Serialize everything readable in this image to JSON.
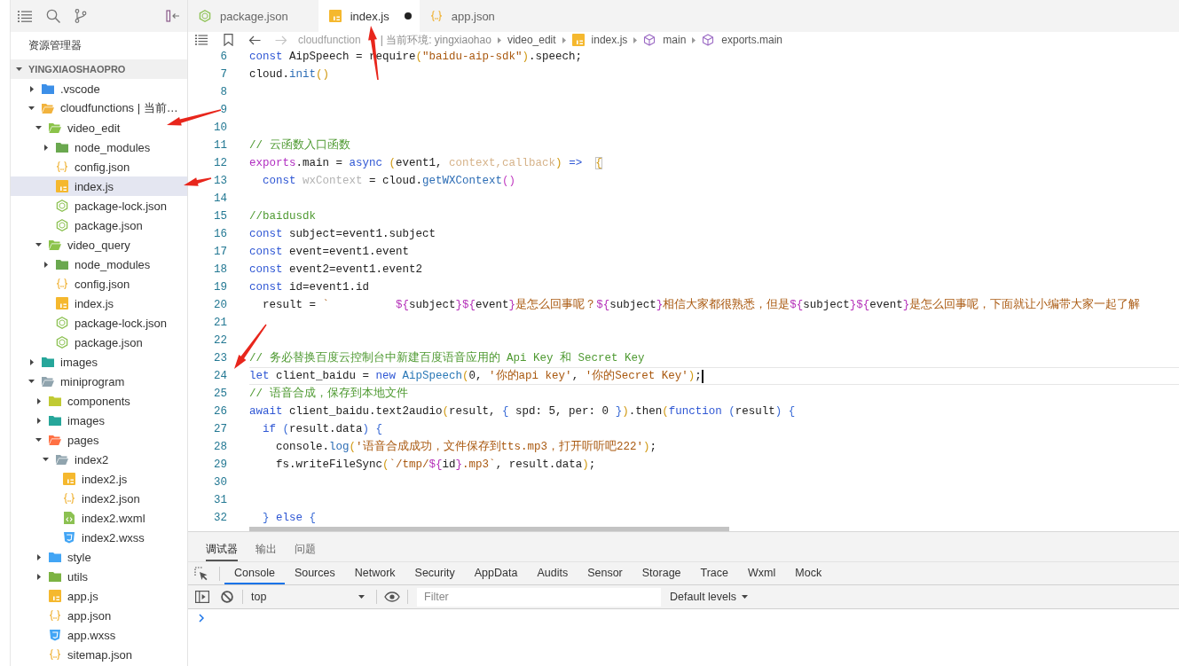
{
  "explorer": {
    "title": "资源管理器",
    "project": {
      "label": "YINGXIAOSHAOPRO",
      "expanded": true
    },
    "tree": [
      {
        "label": ".vscode",
        "kind": "folder",
        "color": "#3c8fe8",
        "expanded": false,
        "selected": false
      },
      {
        "label": "cloudfunctions | 当前…",
        "kind": "folder",
        "color": "#f2b33d",
        "expanded": true,
        "selected": false,
        "children": [
          {
            "label": "video_edit",
            "kind": "folder",
            "color": "#8bc34a",
            "expanded": true,
            "selected": false,
            "children": [
              {
                "label": "node_modules",
                "kind": "folder",
                "color": "#6aa84f",
                "expanded": false,
                "selected": false
              },
              {
                "label": "config.json",
                "kind": "json",
                "selected": false
              },
              {
                "label": "index.js",
                "kind": "js",
                "selected": true
              },
              {
                "label": "package-lock.json",
                "kind": "package",
                "selected": false
              },
              {
                "label": "package.json",
                "kind": "package",
                "selected": false
              }
            ]
          },
          {
            "label": "video_query",
            "kind": "folder",
            "color": "#8bc34a",
            "expanded": true,
            "selected": false,
            "children": [
              {
                "label": "node_modules",
                "kind": "folder",
                "color": "#6aa84f",
                "expanded": false,
                "selected": false
              },
              {
                "label": "config.json",
                "kind": "json",
                "selected": false
              },
              {
                "label": "index.js",
                "kind": "js",
                "selected": false
              },
              {
                "label": "package-lock.json",
                "kind": "package",
                "selected": false
              },
              {
                "label": "package.json",
                "kind": "package",
                "selected": false
              }
            ]
          }
        ]
      },
      {
        "label": "images",
        "kind": "folder",
        "color": "#26a69a",
        "expanded": false,
        "selected": false
      },
      {
        "label": "miniprogram",
        "kind": "folder",
        "color": "#90a4ae",
        "expanded": true,
        "selected": false,
        "children": [
          {
            "label": "components",
            "kind": "folder",
            "color": "#c0ca33",
            "expanded": false,
            "selected": false
          },
          {
            "label": "images",
            "kind": "folder",
            "color": "#26a69a",
            "expanded": false,
            "selected": false
          },
          {
            "label": "pages",
            "kind": "folder",
            "color": "#ff7043",
            "expanded": true,
            "selected": false,
            "children": [
              {
                "label": "index2",
                "kind": "folder",
                "color": "#90a4ae",
                "expanded": true,
                "selected": false,
                "children": [
                  {
                    "label": "index2.js",
                    "kind": "js",
                    "selected": false
                  },
                  {
                    "label": "index2.json",
                    "kind": "json",
                    "selected": false
                  },
                  {
                    "label": "index2.wxml",
                    "kind": "wxml",
                    "selected": false
                  },
                  {
                    "label": "index2.wxss",
                    "kind": "wxss",
                    "selected": false
                  }
                ]
              }
            ]
          },
          {
            "label": "style",
            "kind": "folder",
            "color": "#42a5f5",
            "expanded": false,
            "selected": false
          },
          {
            "label": "utils",
            "kind": "folder",
            "color": "#7cb342",
            "expanded": false,
            "selected": false
          },
          {
            "label": "app.js",
            "kind": "js",
            "selected": false
          },
          {
            "label": "app.json",
            "kind": "json",
            "selected": false
          },
          {
            "label": "app.wxss",
            "kind": "wxss",
            "selected": false
          },
          {
            "label": "sitemap.json",
            "kind": "json",
            "selected": false
          }
        ]
      }
    ]
  },
  "tabs": [
    {
      "label": "package.json",
      "kind": "package",
      "selected": false,
      "modified": false
    },
    {
      "label": "index.js",
      "kind": "js",
      "selected": true,
      "modified": true
    },
    {
      "label": "app.json",
      "kind": "json",
      "selected": false,
      "modified": false
    }
  ],
  "breadcrumb": {
    "back": {
      "disabled": false
    },
    "forward": {
      "disabled": true
    },
    "location": "cloudfunction",
    "environment": "| 当前环境: yingxiaohao",
    "path": [
      {
        "label": "video_edit",
        "kind": "plain"
      },
      {
        "label": "index.js",
        "kind": "js"
      },
      {
        "label": "main",
        "kind": "symbol"
      },
      {
        "label": "exports.main",
        "kind": "symbol"
      }
    ]
  },
  "editor": {
    "lines": [
      {
        "number": "6",
        "current": false,
        "tokens": [
          {
            "text": "const",
            "kind": "keyword"
          },
          {
            "text": " AipSpeech = require",
            "kind": "plain"
          },
          {
            "text": "(",
            "kind": "bracket"
          },
          {
            "text": "\"baidu-aip-sdk\"",
            "kind": "string"
          },
          {
            "text": ")",
            "kind": "bracket"
          },
          {
            "text": ".speech;",
            "kind": "plain"
          }
        ]
      },
      {
        "number": "7",
        "current": false,
        "tokens": [
          {
            "text": "cloud.",
            "kind": "plain"
          },
          {
            "text": "init",
            "kind": "method"
          },
          {
            "text": "()",
            "kind": "bracket"
          }
        ]
      },
      {
        "number": "8",
        "current": false
      },
      {
        "number": "9",
        "current": false
      },
      {
        "number": "10",
        "current": false
      },
      {
        "number": "11",
        "current": false,
        "tokens": [
          {
            "text": "// 云函数入口函数",
            "kind": "comment"
          }
        ]
      },
      {
        "number": "12",
        "current": false,
        "tokens": [
          {
            "text": "exports",
            "kind": "module"
          },
          {
            "text": ".main = ",
            "kind": "plain"
          },
          {
            "text": "async ",
            "kind": "keyword"
          },
          {
            "text": "(",
            "kind": "bracket"
          },
          {
            "text": "event1, ",
            "kind": "plain"
          },
          {
            "text": "context,callback",
            "kind": "faded"
          },
          {
            "text": ")",
            "kind": "bracket"
          },
          {
            "text": " =>  ",
            "kind": "keyword"
          },
          {
            "text": "{",
            "kind": "match"
          }
        ]
      },
      {
        "number": "13",
        "current": false,
        "tokens": [
          {
            "text": "  const ",
            "kind": "keyword"
          },
          {
            "text": "wxContext",
            "kind": "muted"
          },
          {
            "text": " = cloud.",
            "kind": "plain"
          },
          {
            "text": "getWXContext",
            "kind": "method"
          },
          {
            "text": "()",
            "kind": "bracket2"
          }
        ]
      },
      {
        "number": "14",
        "current": false
      },
      {
        "number": "15",
        "current": false,
        "tokens": [
          {
            "text": "//baidusdk",
            "kind": "comment"
          }
        ]
      },
      {
        "number": "16",
        "current": false,
        "tokens": [
          {
            "text": "const",
            "kind": "keyword"
          },
          {
            "text": " subject=event1.subject",
            "kind": "plain"
          }
        ]
      },
      {
        "number": "17",
        "current": false,
        "tokens": [
          {
            "text": "const",
            "kind": "keyword"
          },
          {
            "text": " event=event1.event",
            "kind": "plain"
          }
        ]
      },
      {
        "number": "18",
        "current": false,
        "tokens": [
          {
            "text": "const",
            "kind": "keyword"
          },
          {
            "text": " event2=event1.event2",
            "kind": "plain"
          }
        ]
      },
      {
        "number": "19",
        "current": false,
        "tokens": [
          {
            "text": "const",
            "kind": "keyword"
          },
          {
            "text": " id=event1.id",
            "kind": "plain"
          }
        ]
      },
      {
        "number": "20",
        "current": false,
        "tokens": [
          {
            "text": "  result = ",
            "kind": "plain"
          },
          {
            "text": "`          ",
            "kind": "string"
          },
          {
            "text": "${",
            "kind": "interp"
          },
          {
            "text": "subject",
            "kind": "plain"
          },
          {
            "text": "}",
            "kind": "interp"
          },
          {
            "text": "${",
            "kind": "interp"
          },
          {
            "text": "event",
            "kind": "plain"
          },
          {
            "text": "}",
            "kind": "interp"
          },
          {
            "text": "是怎么回事呢？",
            "kind": "string"
          },
          {
            "text": "${",
            "kind": "interp"
          },
          {
            "text": "subject",
            "kind": "plain"
          },
          {
            "text": "}",
            "kind": "interp"
          },
          {
            "text": "相信大家都很熟悉，但是",
            "kind": "string"
          },
          {
            "text": "${",
            "kind": "interp"
          },
          {
            "text": "subject",
            "kind": "plain"
          },
          {
            "text": "}",
            "kind": "interp"
          },
          {
            "text": "${",
            "kind": "interp"
          },
          {
            "text": "event",
            "kind": "plain"
          },
          {
            "text": "}",
            "kind": "interp"
          },
          {
            "text": "是怎么回事呢，下面就让小编带大家一起了解",
            "kind": "string"
          }
        ]
      },
      {
        "number": "21",
        "current": false
      },
      {
        "number": "22",
        "current": false
      },
      {
        "number": "23",
        "current": false,
        "tokens": [
          {
            "text": "// 务必替换百度云控制台中新建百度语音应用的 Api Key 和 Secret Key",
            "kind": "comment"
          }
        ]
      },
      {
        "number": "24",
        "current": true,
        "tokens": [
          {
            "text": "let",
            "kind": "keyword"
          },
          {
            "text": " client_baidu = ",
            "kind": "plain"
          },
          {
            "text": "new ",
            "kind": "keyword"
          },
          {
            "text": "AipSpeech",
            "kind": "type"
          },
          {
            "text": "(",
            "kind": "bracket"
          },
          {
            "text": "0, ",
            "kind": "plain"
          },
          {
            "text": "'你的api key'",
            "kind": "string"
          },
          {
            "text": ", ",
            "kind": "plain"
          },
          {
            "text": "'你的Secret Key'",
            "kind": "string"
          },
          {
            "text": ")",
            "kind": "bracket"
          },
          {
            "text": ";",
            "kind": "plain"
          }
        ]
      },
      {
        "number": "25",
        "current": false,
        "tokens": [
          {
            "text": "// 语音合成，保存到本地文件",
            "kind": "comment"
          }
        ]
      },
      {
        "number": "26",
        "current": false,
        "tokens": [
          {
            "text": "await",
            "kind": "keyword"
          },
          {
            "text": " client_baidu.text2audio",
            "kind": "plain"
          },
          {
            "text": "(",
            "kind": "bracket"
          },
          {
            "text": "result, ",
            "kind": "plain"
          },
          {
            "text": "{",
            "kind": "bracket3"
          },
          {
            "text": " spd: 5, per: 0 ",
            "kind": "plain"
          },
          {
            "text": "}",
            "kind": "bracket3"
          },
          {
            "text": ")",
            "kind": "bracket"
          },
          {
            "text": ".then",
            "kind": "plain"
          },
          {
            "text": "(",
            "kind": "bracket"
          },
          {
            "text": "function ",
            "kind": "keyword"
          },
          {
            "text": "(",
            "kind": "bracket3"
          },
          {
            "text": "result",
            "kind": "plain"
          },
          {
            "text": ") {",
            "kind": "bracket3"
          }
        ]
      },
      {
        "number": "27",
        "current": false,
        "tokens": [
          {
            "text": "  if ",
            "kind": "keyword"
          },
          {
            "text": "(",
            "kind": "bracket3"
          },
          {
            "text": "result.data",
            "kind": "plain"
          },
          {
            "text": ") {",
            "kind": "bracket3"
          }
        ]
      },
      {
        "number": "28",
        "current": false,
        "tokens": [
          {
            "text": "    console.",
            "kind": "plain"
          },
          {
            "text": "log",
            "kind": "method"
          },
          {
            "text": "(",
            "kind": "bracket"
          },
          {
            "text": "'语音合成成功，文件保存到tts.mp3，打开听听吧222'",
            "kind": "string"
          },
          {
            "text": ")",
            "kind": "bracket"
          },
          {
            "text": ";",
            "kind": "plain"
          }
        ]
      },
      {
        "number": "29",
        "current": false,
        "tokens": [
          {
            "text": "    fs.writeFileSync",
            "kind": "plain"
          },
          {
            "text": "(",
            "kind": "bracket"
          },
          {
            "text": "`/tmp/",
            "kind": "string"
          },
          {
            "text": "${",
            "kind": "interp"
          },
          {
            "text": "id",
            "kind": "plain"
          },
          {
            "text": "}",
            "kind": "interp"
          },
          {
            "text": ".mp3`",
            "kind": "string"
          },
          {
            "text": ", result.data",
            "kind": "plain"
          },
          {
            "text": ")",
            "kind": "bracket"
          },
          {
            "text": ";",
            "kind": "plain"
          }
        ]
      },
      {
        "number": "30",
        "current": false
      },
      {
        "number": "31",
        "current": false
      },
      {
        "number": "32",
        "current": false,
        "tokens": [
          {
            "text": "  }",
            "kind": "bracket3"
          },
          {
            "text": " else ",
            "kind": "keyword"
          },
          {
            "text": "{",
            "kind": "bracket3"
          }
        ]
      }
    ]
  },
  "panel": {
    "tabs": [
      {
        "label": "调试器",
        "selected": true
      },
      {
        "label": "输出",
        "selected": false
      },
      {
        "label": "问题",
        "selected": false
      }
    ],
    "devtools_tabs": [
      {
        "label": "Console",
        "selected": true
      },
      {
        "label": "Sources",
        "selected": false
      },
      {
        "label": "Network",
        "selected": false
      },
      {
        "label": "Security",
        "selected": false
      },
      {
        "label": "AppData",
        "selected": false
      },
      {
        "label": "Audits",
        "selected": false
      },
      {
        "label": "Sensor",
        "selected": false
      },
      {
        "label": "Storage",
        "selected": false
      },
      {
        "label": "Trace",
        "selected": false
      },
      {
        "label": "Wxml",
        "selected": false
      },
      {
        "label": "Mock",
        "selected": false
      }
    ],
    "console": {
      "context": "top",
      "filter": {
        "placeholder": "Filter"
      },
      "levels": "Default levels"
    }
  },
  "annotations": [
    {
      "kind": "arrow"
    },
    {
      "kind": "arrow"
    },
    {
      "kind": "arrow"
    },
    {
      "kind": "arrow"
    }
  ]
}
